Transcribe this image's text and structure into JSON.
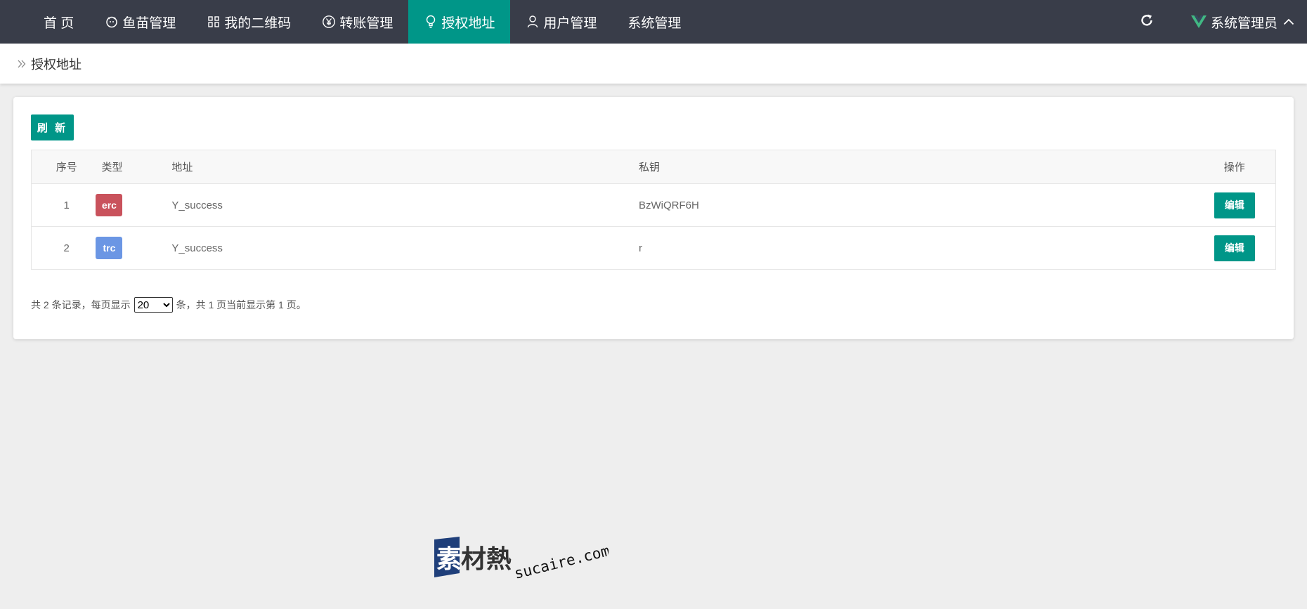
{
  "nav": {
    "items": [
      {
        "label": "首 页",
        "icon": null
      },
      {
        "label": "鱼苗管理",
        "icon": "fish-icon"
      },
      {
        "label": "我的二维码",
        "icon": "qrcode-icon"
      },
      {
        "label": "转账管理",
        "icon": "yen-icon"
      },
      {
        "label": "授权地址",
        "icon": "lightbulb-icon",
        "active": true
      },
      {
        "label": "用户管理",
        "icon": "user-icon"
      },
      {
        "label": "系统管理",
        "icon": null
      }
    ],
    "user_name": "系统管理员"
  },
  "breadcrumb": {
    "current": "授权地址"
  },
  "toolbar": {
    "refresh_label": "刷 新"
  },
  "table": {
    "columns": [
      "序号",
      "类型",
      "地址",
      "私钥",
      "操作"
    ],
    "rows": [
      {
        "index": "1",
        "type": "erc",
        "type_color": "#c9525c",
        "address": "Y_success",
        "private_key": "BzWiQRF6H",
        "action": "编辑"
      },
      {
        "index": "2",
        "type": "trc",
        "type_color": "#6b96e4",
        "address": "Y_success",
        "private_key": "r",
        "action": "编辑"
      }
    ]
  },
  "pager": {
    "prefix": "共 2 条记录，每页显示",
    "page_size": "20",
    "suffix": "条，共 1 页当前显示第 1 页。"
  },
  "watermark": {
    "brand": "素材熱",
    "domain": "sucaire.com"
  },
  "colors": {
    "accent": "#009688",
    "nav_bg": "#393d49",
    "page_bg": "#eeeeee"
  }
}
